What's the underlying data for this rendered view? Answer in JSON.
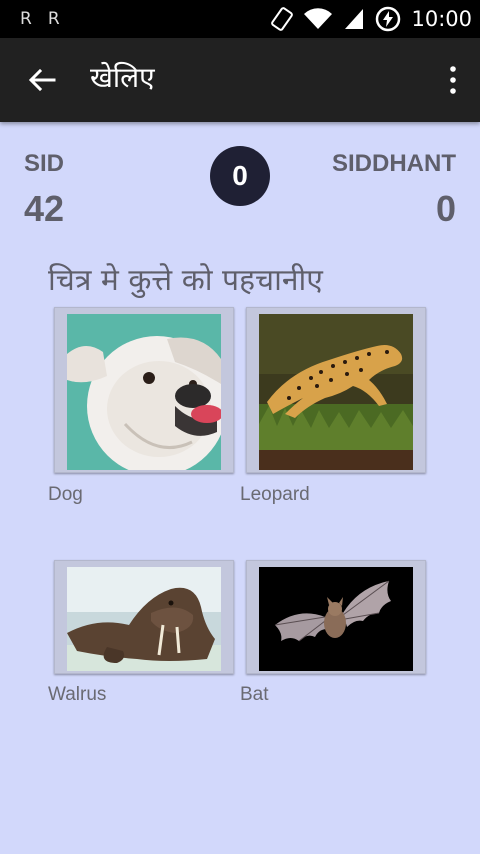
{
  "status_bar": {
    "left_icons": [
      "R",
      "R"
    ],
    "right_icons": [
      "rotate-icon",
      "wifi-icon",
      "signal-icon",
      "battery-charging-icon"
    ],
    "time": "10:00"
  },
  "app_bar": {
    "title": "खेलिए"
  },
  "scoreboard": {
    "player1_name": "SID",
    "player1_score": "42",
    "round": "0",
    "player2_name": "SIDDHANT",
    "player2_score": "0"
  },
  "question": "चित्र मे कुत्ते को पहचानीए",
  "options": [
    {
      "label": "Dog",
      "image": "bulldog-photo"
    },
    {
      "label": "Leopard",
      "image": "cheetah-photo"
    },
    {
      "label": "Walrus",
      "image": "walrus-photo"
    },
    {
      "label": "Bat",
      "image": "bat-photo"
    }
  ],
  "colors": {
    "background": "#d2d8fb",
    "app_bar": "#212121",
    "badge": "#1f2034",
    "text": "#5f5f6b"
  }
}
